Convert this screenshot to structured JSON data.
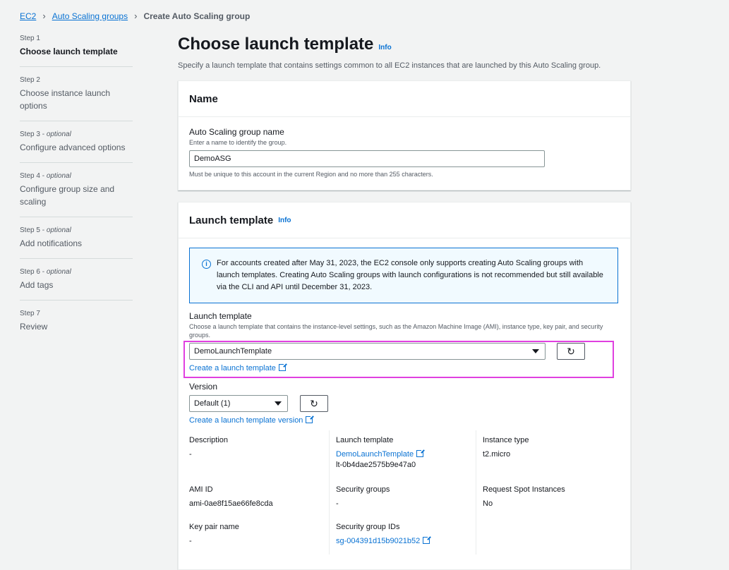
{
  "breadcrumb": {
    "ec2": "EC2",
    "asg": "Auto Scaling groups",
    "current": "Create Auto Scaling group"
  },
  "steps": [
    {
      "no": "Step 1",
      "optional": "",
      "title": "Choose launch template"
    },
    {
      "no": "Step 2",
      "optional": "",
      "title": "Choose instance launch options"
    },
    {
      "no": "Step 3",
      "optional": "optional",
      "title": "Configure advanced options"
    },
    {
      "no": "Step 4",
      "optional": "optional",
      "title": "Configure group size and scaling"
    },
    {
      "no": "Step 5",
      "optional": "optional",
      "title": "Add notifications"
    },
    {
      "no": "Step 6",
      "optional": "optional",
      "title": "Add tags"
    },
    {
      "no": "Step 7",
      "optional": "",
      "title": "Review"
    }
  ],
  "page": {
    "title": "Choose launch template",
    "info": "Info",
    "description": "Specify a launch template that contains settings common to all EC2 instances that are launched by this Auto Scaling group."
  },
  "name_panel": {
    "heading": "Name",
    "label": "Auto Scaling group name",
    "desc": "Enter a name to identify the group.",
    "value": "DemoASG",
    "constraint": "Must be unique to this account in the current Region and no more than 255 characters."
  },
  "lt_panel": {
    "heading": "Launch template",
    "info": "Info",
    "alert": "For accounts created after May 31, 2023, the EC2 console only supports creating Auto Scaling groups with launch templates. Creating Auto Scaling groups with launch configurations is not recommended but still available via the CLI and API until December 31, 2023.",
    "lt_label": "Launch template",
    "lt_desc": "Choose a launch template that contains the instance-level settings, such as the Amazon Machine Image (AMI), instance type, key pair, and security groups.",
    "lt_selected": "DemoLaunchTemplate",
    "create_lt": "Create a launch template",
    "version_label": "Version",
    "version_selected": "Default (1)",
    "create_version": "Create a launch template version",
    "details": {
      "description_k": "Description",
      "description_v": "-",
      "lt_k": "Launch template",
      "lt_v": "DemoLaunchTemplate",
      "lt_id": "lt-0b4dae2575b9e47a0",
      "type_k": "Instance type",
      "type_v": "t2.micro",
      "ami_k": "AMI ID",
      "ami_v": "ami-0ae8f15ae66fe8cda",
      "sg_k": "Security groups",
      "sg_v": "-",
      "spot_k": "Request Spot Instances",
      "spot_v": "No",
      "kp_k": "Key pair name",
      "kp_v": "-",
      "sgid_k": "Security group IDs",
      "sgid_v": "sg-004391d15b9021b52"
    }
  },
  "colors": {
    "link": "#0972d3",
    "highlight": "#e040e0",
    "background": "#f2f3f3"
  }
}
